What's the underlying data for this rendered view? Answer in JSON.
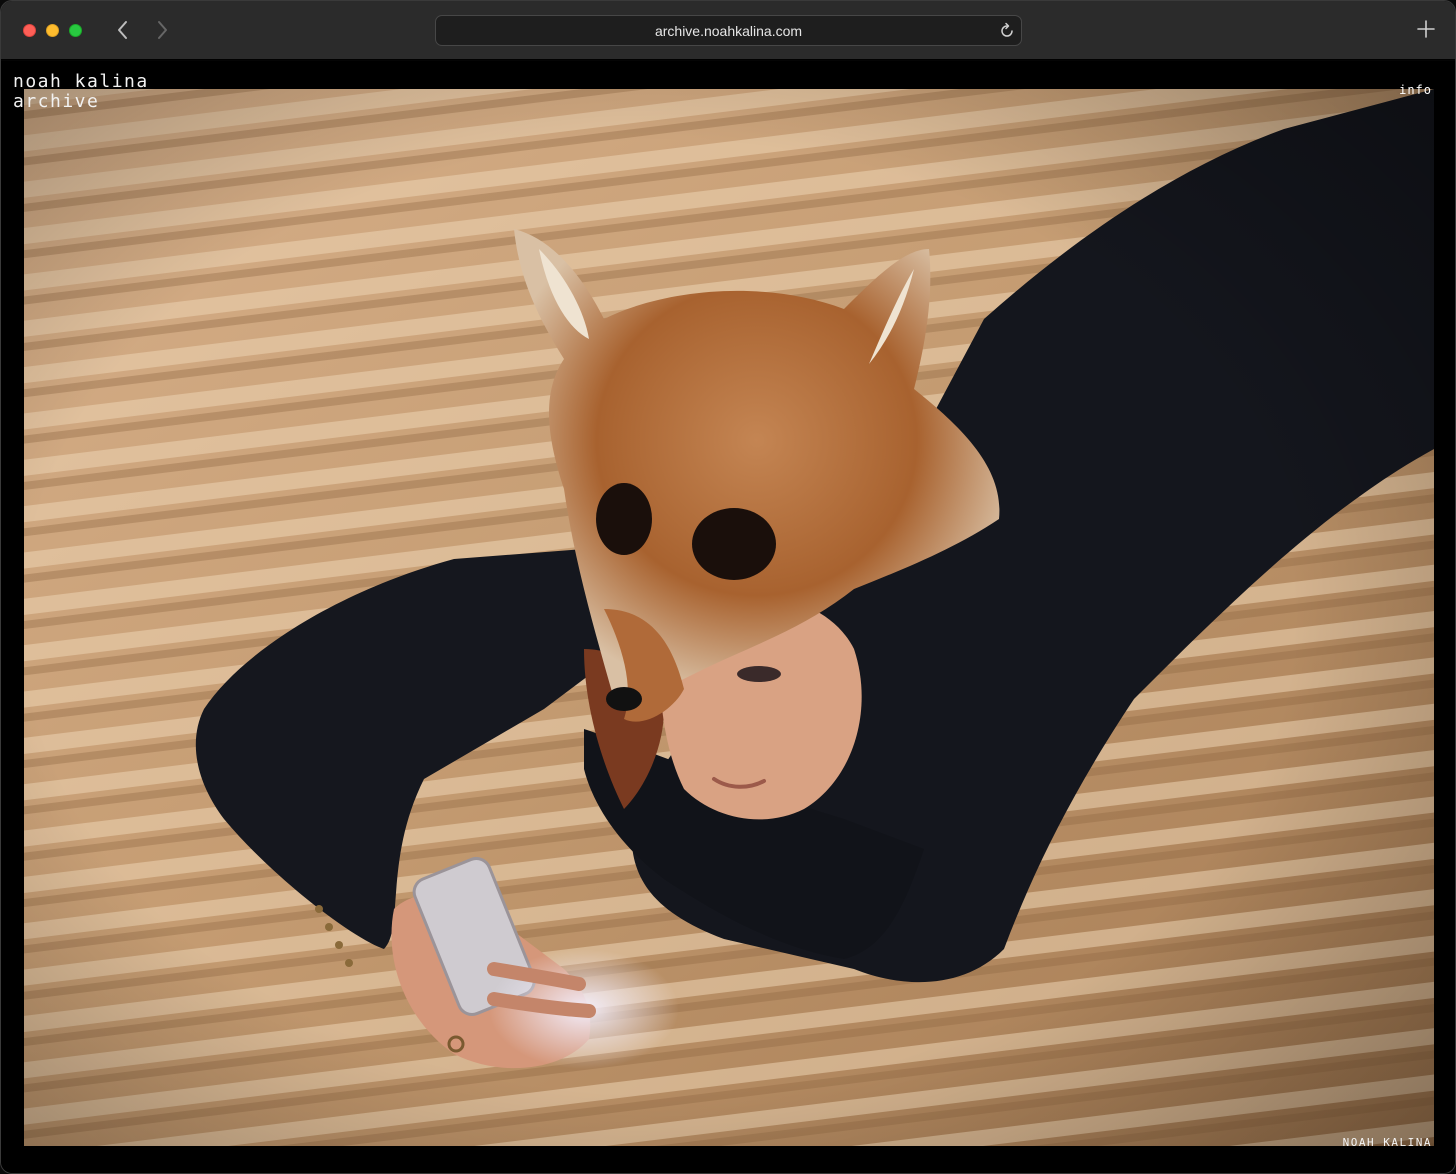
{
  "browser": {
    "url": "archive.noahkalina.com",
    "icons": {
      "back": "chevron-left-icon",
      "forward": "chevron-right-icon",
      "reload": "reload-icon",
      "new_tab": "plus-icon"
    }
  },
  "site": {
    "title_line1": "noah kalina",
    "title_line2": "archive",
    "info_link": "info",
    "photo_credit": "NOAH KALINA"
  },
  "photo": {
    "subject": "woman in fox-head mask lying on striped bedspread looking at phone"
  },
  "colors": {
    "toolbar": "#2b2b2b",
    "page_background": "#000000",
    "bedspread": "#c9a27a",
    "sweater": "#14161d",
    "fox_fur": "#a9683a"
  }
}
